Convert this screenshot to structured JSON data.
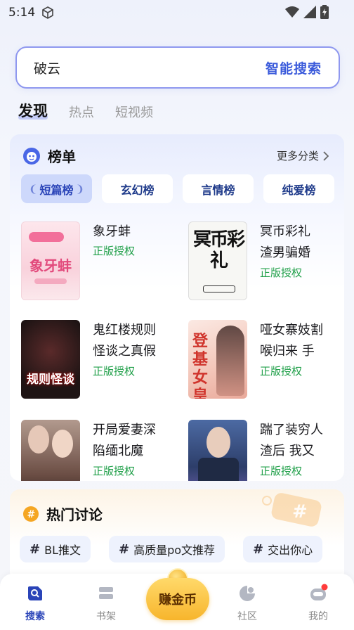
{
  "status": {
    "time": "5:14"
  },
  "search": {
    "query": "破云",
    "smart_label": "智能搜索"
  },
  "top_tabs": [
    {
      "label": "发现",
      "active": true
    },
    {
      "label": "热点",
      "active": false
    },
    {
      "label": "短视频",
      "active": false
    }
  ],
  "rank": {
    "title": "榜单",
    "more_label": "更多分类",
    "tabs": [
      {
        "label": "短篇榜",
        "active": true
      },
      {
        "label": "玄幻榜",
        "active": false
      },
      {
        "label": "言情榜",
        "active": false
      },
      {
        "label": "纯爱榜",
        "active": false
      }
    ],
    "books": [
      {
        "title": "象牙蚌",
        "badge": "正版授权",
        "cover_text": "象牙蚌"
      },
      {
        "title": "冥币彩礼\n渣男骗婚",
        "badge": "正版授权",
        "cover_text": "冥币彩礼"
      },
      {
        "title": "鬼红楼规则\n怪谈之真假",
        "badge": "正版授权",
        "cover_text": "规则怪谈"
      },
      {
        "title": "哑女寨妓割\n喉归来 手",
        "badge": "正版授权",
        "cover_text": "登基女皇"
      },
      {
        "title": "开局爱妻深\n陷缅北魔",
        "badge": "正版授权",
        "cover_text": ""
      },
      {
        "title": "踹了装穷人\n渣后 我又",
        "badge": "正版授权",
        "cover_text": ""
      }
    ]
  },
  "hot": {
    "title": "热门讨论",
    "chips": [
      {
        "hash": "#",
        "label": "BL推文"
      },
      {
        "hash": "#",
        "label": "高质量po文推荐"
      },
      {
        "hash": "#",
        "label": "交出你心"
      }
    ]
  },
  "nav": {
    "search": "搜索",
    "shelf": "书架",
    "earn": "赚金币",
    "community": "社区",
    "mine": "我的"
  },
  "colors": {
    "accent": "#3b5bdb",
    "license_green": "#21a04a",
    "badge_red": "#ff3b3b"
  }
}
